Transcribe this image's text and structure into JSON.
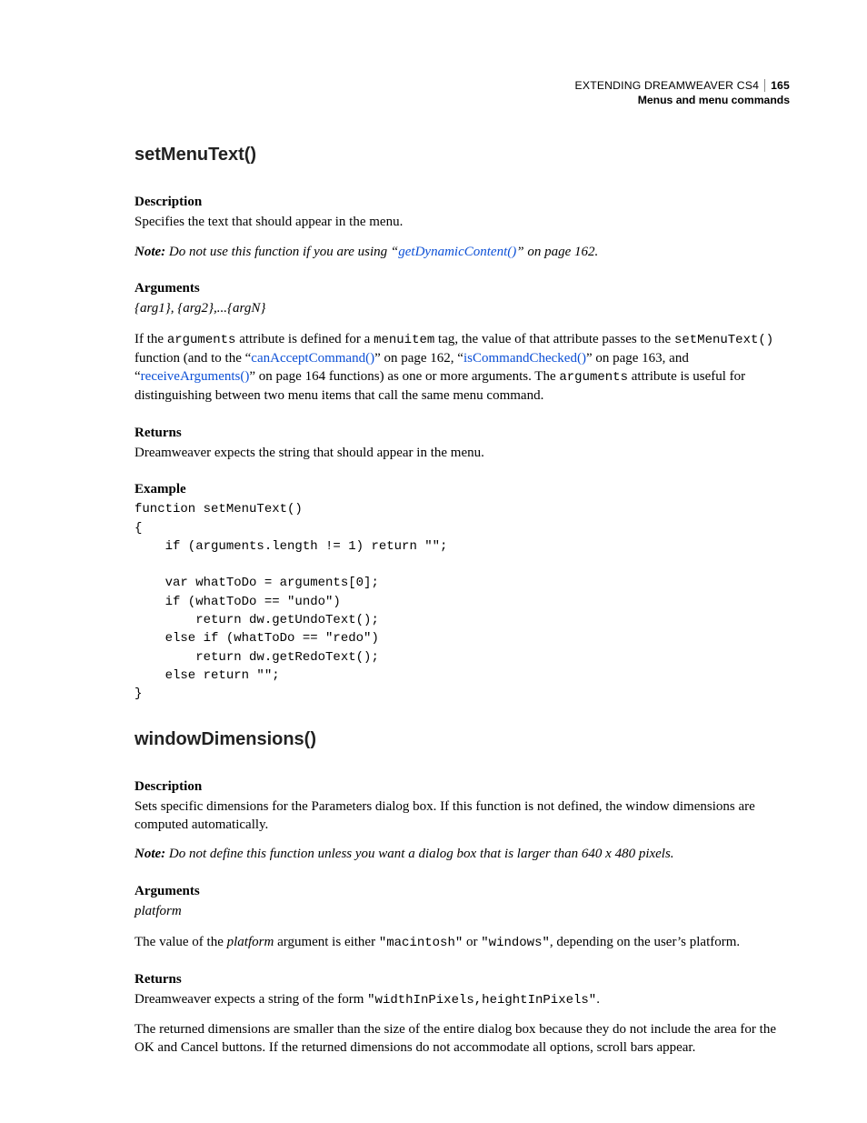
{
  "header": {
    "doc_title": "EXTENDING DREAMWEAVER CS4",
    "page_number": "165",
    "section": "Menus and menu commands"
  },
  "s1": {
    "title": "setMenuText()",
    "desc_h": "Description",
    "desc_p": "Specifies the text that should appear in the menu.",
    "note_lead": "Note: ",
    "note_a": "Do not use this function if you are using “",
    "note_link": "getDynamicContent()",
    "note_b": "” on page 162.",
    "args_h": "Arguments",
    "args_sig": "{arg1}, {arg2},...{argN}",
    "p1a": "If the ",
    "p1_code1": "arguments",
    "p1b": " attribute is defined for a ",
    "p1_code2": "menuitem",
    "p1c": " tag, the value of that attribute passes to the ",
    "p1_code3": "setMenuText()",
    "p1d": " function (and to the “",
    "p1_link1": "canAcceptCommand()",
    "p1e": "” on page 162, “",
    "p1_link2": "isCommandChecked()",
    "p1f": "” on page 163, and “",
    "p1_link3": "receiveArguments()",
    "p1g": "” on page 164 functions) as one or more arguments. The ",
    "p1_code4": "arguments",
    "p1h": " attribute is useful for distinguishing between two menu items that call the same menu command.",
    "ret_h": "Returns",
    "ret_p": "Dreamweaver expects the string that should appear in the menu.",
    "ex_h": "Example",
    "ex_code": "function setMenuText()\n{\n    if (arguments.length != 1) return \"\";\n\n    var whatToDo = arguments[0];\n    if (whatToDo == \"undo\")\n        return dw.getUndoText();\n    else if (whatToDo == \"redo\")\n        return dw.getRedoText();\n    else return \"\";\n}"
  },
  "s2": {
    "title": "windowDimensions()",
    "desc_h": "Description",
    "desc_p": "Sets specific dimensions for the Parameters dialog box. If this function is not defined, the window dimensions are computed automatically.",
    "note_lead": "Note: ",
    "note_body": "Do not define this function unless you want a dialog box that is larger than 640 x 480 pixels.",
    "args_h": "Arguments",
    "args_sig": "platform",
    "p1a": "The value of the ",
    "p1_em": "platform",
    "p1b": " argument is either ",
    "p1_code1": "\"macintosh\"",
    "p1c": " or ",
    "p1_code2": "\"windows\"",
    "p1d": ", depending on the user’s platform.",
    "ret_h": "Returns",
    "ret_p1a": "Dreamweaver expects a string of the form ",
    "ret_code": "\"widthInPixels,heightInPixels\"",
    "ret_p1b": ".",
    "ret_p2": "The returned dimensions are smaller than the size of the entire dialog box because they do not include the area for the OK and Cancel buttons. If the returned dimensions do not accommodate all options, scroll bars appear."
  }
}
